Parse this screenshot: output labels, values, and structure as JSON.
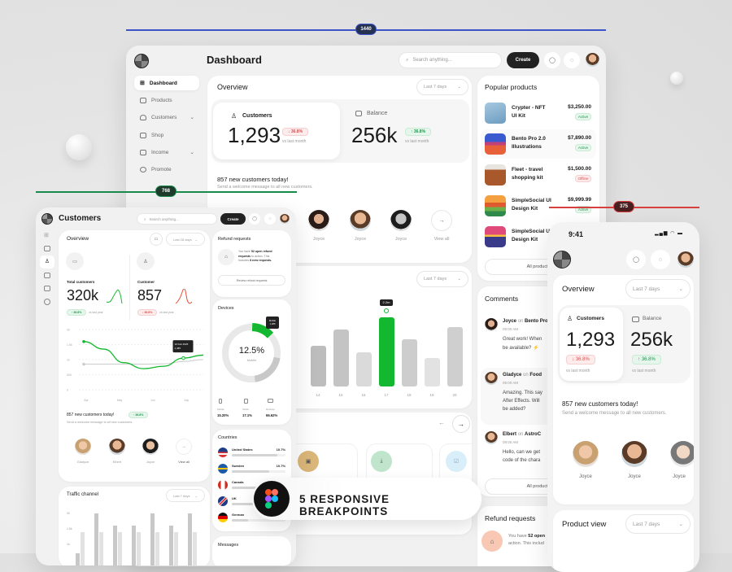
{
  "breakpoints": {
    "desktop": "1440",
    "tablet": "768",
    "mobile": "375"
  },
  "colors": {
    "accent_green": "#14b830",
    "down_red": "#e04a4a",
    "ruler_blue": "#3b55c8",
    "ruler_green": "#1a8a4a",
    "ruler_red": "#d84040"
  },
  "banner": {
    "text": "5 RESPONSIVE BREAKPOINTS",
    "icon": "figma-logo-icon"
  },
  "desktop": {
    "title": "Dashboard",
    "search_placeholder": "Search anything...",
    "create_label": "Create",
    "sidebar": [
      {
        "label": "Dashboard",
        "icon": "grid-icon",
        "active": true
      },
      {
        "label": "Products",
        "icon": "bag-icon"
      },
      {
        "label": "Customers",
        "icon": "user-icon",
        "expandable": true
      },
      {
        "label": "Shop",
        "icon": "shop-icon"
      },
      {
        "label": "Income",
        "icon": "chart-icon",
        "expandable": true
      },
      {
        "label": "Promote",
        "icon": "circle-icon"
      }
    ],
    "overview": {
      "title": "Overview",
      "period": "Last 7 days",
      "customers": {
        "label": "Customers",
        "value": "1,293",
        "change": "↓ 36.8%",
        "note": "vs last month"
      },
      "balance": {
        "label": "Balance",
        "value": "256k",
        "change": "↑ 36.8%",
        "note": "vs last month"
      },
      "headline": "857 new customers today!",
      "subtitle": "Send a welcome message to all new customers.",
      "avatars": [
        "Joyce",
        "Joyce",
        "Joyce"
      ],
      "view_all": "View all"
    },
    "product_view": {
      "period": "Last 7 days",
      "categories": [
        "14",
        "15",
        "16",
        "17",
        "18",
        "19",
        "20"
      ],
      "values": [
        1.3,
        1.8,
        1.1,
        2.2,
        1.5,
        0.9,
        1.9
      ],
      "highlight_index": 3,
      "tooltip": "2.2m"
    },
    "popular_products": {
      "title": "Popular products",
      "items": [
        {
          "name1": "Crypter - NFT",
          "name2": "UI Kit",
          "price": "$3,250.00",
          "status": "Active"
        },
        {
          "name1": "Bento Pro 2.0",
          "name2": "Illustrations",
          "price": "$7,890.00",
          "status": "Active"
        },
        {
          "name1": "Fleet - travel",
          "name2": "shopping kit",
          "price": "$1,500.00",
          "status": "Offline"
        },
        {
          "name1": "SimpleSocial UI",
          "name2": "Design Kit",
          "price": "$9,999.99",
          "status": "Active"
        },
        {
          "name1": "SimpleSocial UI",
          "name2": "Design Kit"
        }
      ],
      "all_label": "All products"
    },
    "comments": {
      "title": "Comments",
      "items": [
        {
          "author": "Joyce",
          "on": "on",
          "product": "Bento Pro",
          "time": "09:00 AM",
          "line1": "Great work! When",
          "line2": "be available? ⚡"
        },
        {
          "author": "Gladyce",
          "on": "on",
          "product": "Food",
          "time": "09:00 AM",
          "line1": "Amazing. This say",
          "line2": "After Effects. Will",
          "line3": "be added?"
        },
        {
          "author": "Elbert",
          "on": "on",
          "product": "AstroC",
          "time": "09:00 AM",
          "line1": "Hello, can we get",
          "line2": "code of the chara"
        }
      ],
      "all_label": "All products"
    },
    "refund": {
      "title": "Refund requests",
      "pre": "You have ",
      "count": "52 open",
      "line2": "action. This includ"
    }
  },
  "tablet": {
    "title": "Customers",
    "search_placeholder": "Search anything...",
    "create_label": "Create",
    "overview": {
      "title": "Overview",
      "period": "Last 28 days",
      "total": {
        "label": "Total customers",
        "value": "320k",
        "change": "↑ 36.8%",
        "note": "vs last year"
      },
      "customer": {
        "label": "Customer",
        "value": "857",
        "change": "↓ 36.8%",
        "note": "vs last year"
      },
      "chart": {
        "type": "line",
        "y_ticks": [
          "2k",
          "1.5k",
          "1k",
          "500",
          "0"
        ],
        "x_ticks": [
          "Apr",
          "May",
          "Jun",
          "July"
        ],
        "series": [
          {
            "color": "#14b830",
            "values": [
              1600,
              1350,
              900,
              700,
              780,
              1050,
              1150
            ]
          },
          {
            "color": "#cccccc",
            "values": [
              850,
              850,
              850,
              850,
              860,
              940,
              1000
            ]
          }
        ],
        "tooltip": {
          "date": "10 Feb 2025",
          "value": "1,485"
        }
      },
      "headline": "857 new customers today!",
      "headline_badge": "↑ 36.8%",
      "subtitle": "Send a welcome message to all new customers.",
      "avatars": [
        "Gladyce",
        "Elbert",
        "Joyce"
      ],
      "view_all": "View all"
    },
    "traffic": {
      "title": "Traffic channel",
      "period": "Last 7 days",
      "y_ticks": [
        "2k",
        "1.5k",
        "1k"
      ],
      "pairs": [
        [
          700,
          1400
        ],
        [
          2000,
          1400
        ],
        [
          1600,
          1400
        ],
        [
          1600,
          1400
        ],
        [
          2000,
          1400
        ],
        [
          1600,
          1400
        ],
        [
          2000,
          1400
        ]
      ]
    },
    "refund": {
      "title": "Refund requests",
      "l1a": "You have ",
      "l1b": "52 open refund",
      "l2a": "requests",
      "l2b": " to action. This",
      "l3a": "includes ",
      "l3b": "8 new requests.",
      "button": "Review refund requests"
    },
    "devices": {
      "title": "Devices",
      "value": "12.5%",
      "value_label": "Mobile",
      "share": 0.125,
      "tooltip_label": "Mobile",
      "tooltip_value": "1,485",
      "legend": [
        {
          "label": "Mobile",
          "value": "15.20%"
        },
        {
          "label": "Tablet",
          "value": "17.1%"
        },
        {
          "label": "Desktop",
          "value": "66.62%"
        }
      ]
    },
    "countries": {
      "title": "Countries",
      "items": [
        {
          "name": "United States",
          "value": "10.7%",
          "fill": 0.85
        },
        {
          "name": "Sweden",
          "value": "10.7%",
          "fill": 0.7
        },
        {
          "name": "Canada",
          "value": "",
          "fill": 0.55
        },
        {
          "name": "UK",
          "value": "",
          "fill": 0.45
        },
        {
          "name": "German",
          "value": "",
          "fill": 0.3
        }
      ]
    },
    "messages": {
      "title": "Messages"
    }
  },
  "mobile": {
    "time": "9:41",
    "overview": {
      "title": "Overview",
      "period": "Last 7 days",
      "customers": {
        "label": "Customers",
        "value": "1,293",
        "change": "↓ 36.8%",
        "note": "vs last month"
      },
      "balance": {
        "label": "Balance",
        "value": "256k",
        "change": "↑ 36.8%",
        "note": "vs last month"
      },
      "headline": "857 new customers today!",
      "subtitle": "Send a welcome message to all new customers.",
      "avatars": [
        "Joyce",
        "Joyce",
        "Joyce"
      ]
    },
    "product_view": {
      "title": "Product view",
      "period": "Last 7 days"
    }
  }
}
